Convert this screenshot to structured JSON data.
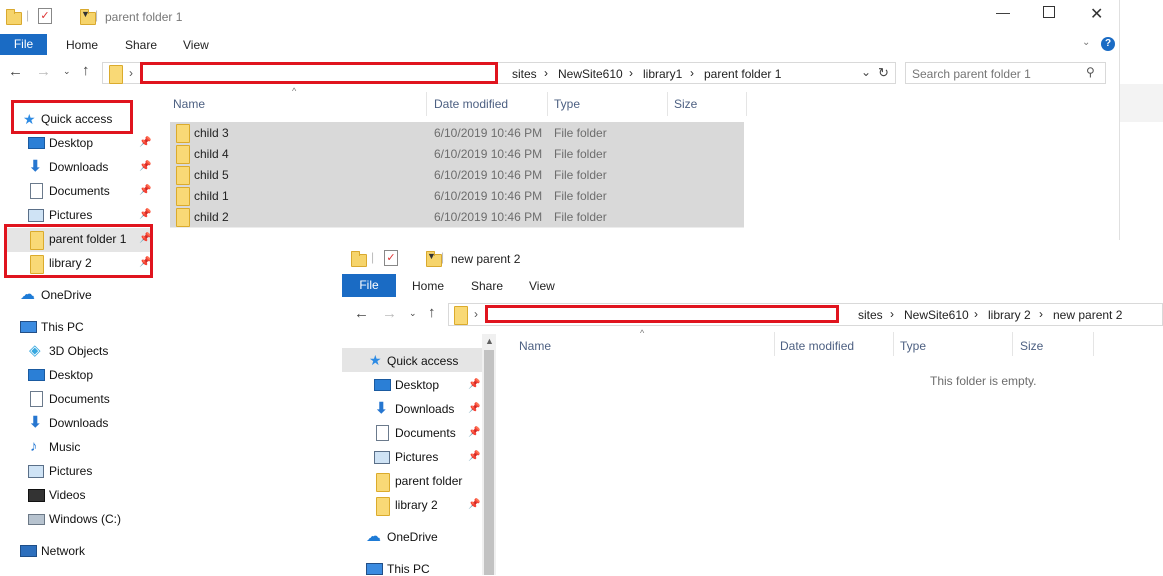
{
  "win1": {
    "title": "parent folder 1",
    "ribbon": {
      "file": "File",
      "home": "Home",
      "share": "Share",
      "view": "View"
    },
    "breadcrumbs": [
      "sites",
      "NewSite610",
      "library1",
      "parent folder 1"
    ],
    "search_placeholder": "Search parent folder 1",
    "columns": {
      "name": "Name",
      "date": "Date modified",
      "type": "Type",
      "size": "Size"
    },
    "rows": [
      {
        "name": "child 3",
        "date": "6/10/2019 10:46 PM",
        "type": "File folder"
      },
      {
        "name": "child 4",
        "date": "6/10/2019 10:46 PM",
        "type": "File folder"
      },
      {
        "name": "child 5",
        "date": "6/10/2019 10:46 PM",
        "type": "File folder"
      },
      {
        "name": "child 1",
        "date": "6/10/2019 10:46 PM",
        "type": "File folder"
      },
      {
        "name": "child 2",
        "date": "6/10/2019 10:46 PM",
        "type": "File folder"
      }
    ],
    "nav": {
      "quick_access": "Quick access",
      "desktop": "Desktop",
      "downloads": "Downloads",
      "documents": "Documents",
      "pictures": "Pictures",
      "parent_folder": "parent folder 1",
      "library2": "library 2",
      "onedrive": "OneDrive",
      "this_pc": "This PC",
      "objects3d": "3D Objects",
      "pc_desktop": "Desktop",
      "pc_documents": "Documents",
      "pc_downloads": "Downloads",
      "music": "Music",
      "pc_pictures": "Pictures",
      "videos": "Videos",
      "windows_c": "Windows (C:)",
      "network": "Network"
    }
  },
  "win2": {
    "title": "new parent 2",
    "ribbon": {
      "file": "File",
      "home": "Home",
      "share": "Share",
      "view": "View"
    },
    "breadcrumbs": [
      "sites",
      "NewSite610",
      "library 2",
      "new parent 2"
    ],
    "columns": {
      "name": "Name",
      "date": "Date modified",
      "type": "Type",
      "size": "Size"
    },
    "empty_text": "This folder is empty.",
    "nav": {
      "quick_access": "Quick access",
      "desktop": "Desktop",
      "downloads": "Downloads",
      "documents": "Documents",
      "pictures": "Pictures",
      "parent_folder": "parent folder",
      "library2": "library 2",
      "onedrive": "OneDrive",
      "this_pc": "This PC"
    }
  },
  "colors": {
    "file_tab": "#1a6bc4",
    "highlight": "#e0141e",
    "row_selected": "#d9d9d9"
  }
}
